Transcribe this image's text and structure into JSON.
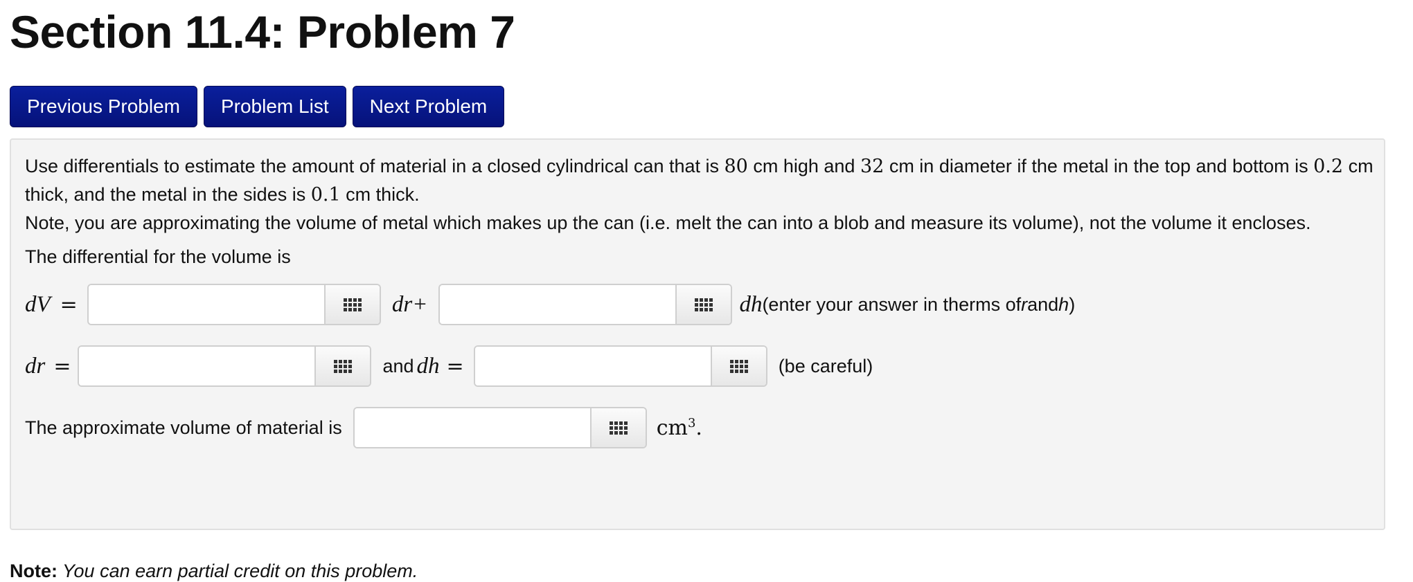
{
  "page": {
    "title": "Section 11.4: Problem 7"
  },
  "nav": {
    "previous": "Previous Problem",
    "list": "Problem List",
    "next": "Next Problem"
  },
  "problem": {
    "text1_a": "Use differentials to estimate the amount of material in a closed cylindrical can that is ",
    "height_value": "80",
    "text1_b": " cm high and ",
    "diameter_value": "32",
    "text1_c": " cm in diameter if the metal in the top and bottom is ",
    "topbottom_thickness": "0.2",
    "text1_d": " cm thick, and the metal in the sides is ",
    "side_thickness": "0.1",
    "text1_e": " cm thick.",
    "text2": "Note, you are approximating the volume of metal which makes up the can (i.e. melt the can into a blob and measure its volume), not the volume it encloses.",
    "differential_intro": "The differential for the volume is",
    "dV_label": "dV",
    "equals": "=",
    "dr_term": "dr+",
    "dh_term": "dh",
    "dV_hint_a": " (enter your answer in therms of ",
    "r_var": "r",
    "hint_and": " and ",
    "h_var": "h",
    "hint_close": " )",
    "dr_label": "dr",
    "and_text": "and ",
    "dh_label": "dh",
    "be_careful": "(be careful)",
    "approx_label": "The approximate volume of material is",
    "unit": "cm",
    "unit_exp": "3",
    "period": "."
  },
  "inputs": {
    "dV_coef_dr": "",
    "dV_coef_dh": "",
    "dr_value": "",
    "dh_value": "",
    "volume_value": ""
  },
  "note": {
    "label": "Note:",
    "text": " You can earn partial credit on this problem."
  }
}
